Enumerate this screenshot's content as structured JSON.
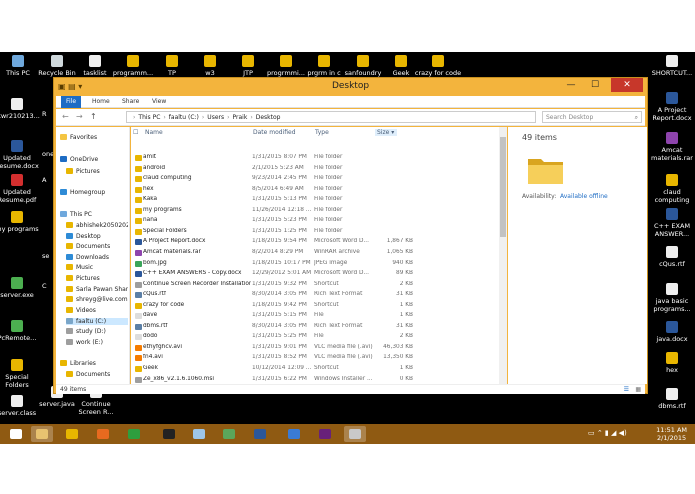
{
  "desktop": {
    "top_icons": [
      {
        "label": "This PC",
        "icon": "this-pc-icon",
        "color": "#6fa8dc"
      },
      {
        "label": "Recycle Bin",
        "icon": "recycle-bin-icon",
        "color": "#cfd8dc"
      },
      {
        "label": "tasklist",
        "icon": "text-file-icon",
        "color": "#eeeeee"
      },
      {
        "label": "programm...",
        "icon": "chrome-shortcut-icon",
        "color": "#e8b600"
      },
      {
        "label": "TP",
        "icon": "chrome-shortcut-icon",
        "color": "#e8b600"
      },
      {
        "label": "w3",
        "icon": "chrome-shortcut-icon",
        "color": "#e8b600"
      },
      {
        "label": "JTP",
        "icon": "chrome-shortcut-icon",
        "color": "#e8b600"
      },
      {
        "label": "progrmmi...",
        "icon": "chrome-shortcut-icon",
        "color": "#e8b600"
      },
      {
        "label": "prgrm in c",
        "icon": "chrome-shortcut-icon",
        "color": "#e8b600"
      },
      {
        "label": "sanfoundry",
        "icon": "chrome-shortcut-icon",
        "color": "#e8b600"
      },
      {
        "label": "Geek",
        "icon": "chrome-shortcut-icon",
        "color": "#e8b600"
      },
      {
        "label": "crazy for code",
        "icon": "chrome-shortcut-icon",
        "color": "#e8b600"
      },
      {
        "label": "SHORTCUT...",
        "icon": "document-icon",
        "color": "#eeeeee"
      }
    ],
    "left_icons": [
      {
        "label": "ptwr210213...",
        "icon": "document-icon",
        "color": "#eeeeee"
      },
      {
        "label": "Updated Resume.docx",
        "icon": "word-doc-icon",
        "color": "#2b579a"
      },
      {
        "label": "Updated Resume.pdf",
        "icon": "pdf-icon",
        "color": "#d32f2f"
      },
      {
        "label": "my programs",
        "icon": "folder-icon",
        "color": "#e8b600"
      },
      {
        "label": "server.exe",
        "icon": "exe-icon",
        "color": "#4caf50"
      },
      {
        "label": "PcRemote...",
        "icon": "exe-icon",
        "color": "#4caf50"
      },
      {
        "label": "Special Folders",
        "icon": "folder-icon",
        "color": "#e8b600"
      },
      {
        "label": "server.class",
        "icon": "java-class-icon",
        "color": "#eeeeee"
      }
    ],
    "left_partial_labels": [
      "R",
      "one",
      "A",
      "se",
      "C"
    ],
    "bottom_icons": [
      {
        "label": "server.java",
        "icon": "java-file-icon",
        "color": "#eeeeee"
      },
      {
        "label": "Continue Screen R...",
        "icon": "shortcut-icon",
        "color": "#eeeeee"
      }
    ],
    "right_icons": [
      {
        "label": "A Project Report.docx",
        "icon": "word-doc-icon",
        "color": "#2b579a"
      },
      {
        "label": "Amcat materials.rar",
        "icon": "rar-icon",
        "color": "#8e44ad"
      },
      {
        "label": "claud computing",
        "icon": "folder-icon",
        "color": "#e8b600"
      },
      {
        "label": "C++ EXAM ANSWER...",
        "icon": "word-doc-icon",
        "color": "#2b579a"
      },
      {
        "label": "cQus.rtf",
        "icon": "rtf-icon",
        "color": "#eeeeee"
      },
      {
        "label": "java basic programs...",
        "icon": "rtf-icon",
        "color": "#eeeeee"
      },
      {
        "label": "java.docx",
        "icon": "word-doc-icon",
        "color": "#2b579a"
      },
      {
        "label": "hex",
        "icon": "folder-icon",
        "color": "#e8b600"
      },
      {
        "label": "dbms.rtf",
        "icon": "rtf-icon",
        "color": "#eeeeee"
      }
    ]
  },
  "window": {
    "title": "Desktop",
    "ribbon_tabs": [
      "File",
      "Home",
      "Share",
      "View"
    ],
    "path": [
      "This PC",
      "faaltu (C:)",
      "Users",
      "Praik",
      "Desktop"
    ],
    "path_sep": "›",
    "search_placeholder": "Search Desktop",
    "nav_back": "←",
    "nav_forward": "→",
    "nav_up": "↑",
    "min": "—",
    "max": "☐",
    "close": "✕",
    "columns": {
      "name": "Name",
      "date": "Date modified",
      "type": "Type",
      "size": "Size"
    },
    "nav_items": [
      {
        "label": "Favorites",
        "icon": "star-icon",
        "color": "#f4c542",
        "indent": 0
      },
      {
        "label": "OneDrive",
        "icon": "cloud-icon",
        "color": "#1e6cc4",
        "indent": 0
      },
      {
        "label": "Pictures",
        "icon": "folder-icon",
        "color": "#e8b600",
        "indent": 1
      },
      {
        "label": "Homegroup",
        "icon": "homegroup-icon",
        "color": "#2e8bd6",
        "indent": 0
      },
      {
        "label": "This PC",
        "icon": "this-pc-icon",
        "color": "#6fa8dc",
        "indent": 0
      },
      {
        "label": "abhishek2050202",
        "icon": "folder-icon",
        "color": "#e8b600",
        "indent": 1
      },
      {
        "label": "Desktop",
        "icon": "desktop-icon",
        "color": "#2e8bd6",
        "indent": 1
      },
      {
        "label": "Documents",
        "icon": "folder-icon",
        "color": "#e8b600",
        "indent": 1
      },
      {
        "label": "Downloads",
        "icon": "download-icon",
        "color": "#2e8bd6",
        "indent": 1
      },
      {
        "label": "Music",
        "icon": "music-icon",
        "color": "#e8b600",
        "indent": 1
      },
      {
        "label": "Pictures",
        "icon": "folder-icon",
        "color": "#e8b600",
        "indent": 1
      },
      {
        "label": "Sarla Pawan Shar",
        "icon": "folder-icon",
        "color": "#e8b600",
        "indent": 1
      },
      {
        "label": "shreyg@live.com",
        "icon": "folder-icon",
        "color": "#e8b600",
        "indent": 1
      },
      {
        "label": "Videos",
        "icon": "video-icon",
        "color": "#e8b600",
        "indent": 1
      },
      {
        "label": "faaltu (C:)",
        "icon": "drive-icon",
        "color": "#7aa6c9",
        "indent": 1,
        "selected": true
      },
      {
        "label": "study (D:)",
        "icon": "drive-icon",
        "color": "#9e9e9e",
        "indent": 1
      },
      {
        "label": "work (E:)",
        "icon": "drive-icon",
        "color": "#9e9e9e",
        "indent": 1
      },
      {
        "label": "Libraries",
        "icon": "library-icon",
        "color": "#e8b600",
        "indent": 0
      },
      {
        "label": "Documents",
        "icon": "folder-icon",
        "color": "#e8b600",
        "indent": 1
      }
    ],
    "files": [
      {
        "name": "amit",
        "date": "1/31/2015 8:07 PM",
        "type": "File folder",
        "size": "",
        "color": "#e8b600"
      },
      {
        "name": "android",
        "date": "2/1/2015 5:23 AM",
        "type": "File folder",
        "size": "",
        "color": "#e8b600"
      },
      {
        "name": "claud computing",
        "date": "9/23/2014 2:45 PM",
        "type": "File folder",
        "size": "",
        "color": "#e8b600"
      },
      {
        "name": "hex",
        "date": "8/5/2014 6:49 AM",
        "type": "File folder",
        "size": "",
        "color": "#e8b600"
      },
      {
        "name": "Kaka",
        "date": "1/31/2015 5:13 PM",
        "type": "File folder",
        "size": "",
        "color": "#e8b600"
      },
      {
        "name": "my programs",
        "date": "11/26/2014 12:18 ...",
        "type": "File folder",
        "size": "",
        "color": "#e8b600"
      },
      {
        "name": "nana",
        "date": "1/31/2015 5:23 PM",
        "type": "File folder",
        "size": "",
        "color": "#e8b600"
      },
      {
        "name": "Special Folders",
        "date": "1/31/2015 1:25 PM",
        "type": "File folder",
        "size": "",
        "color": "#e8b600"
      },
      {
        "name": "A Project Report.docx",
        "date": "1/18/2015 9:54 PM",
        "type": "Microsoft Word D...",
        "size": "1,867 KB",
        "color": "#2b579a"
      },
      {
        "name": "Amcat materials.rar",
        "date": "8/2/2014 8:29 PM",
        "type": "WinRAR archive",
        "size": "1,065 KB",
        "color": "#8e44ad"
      },
      {
        "name": "bom.jpg",
        "date": "1/18/2015 10:17 PM",
        "type": "JPEG image",
        "size": "940 KB",
        "color": "#3aa55a"
      },
      {
        "name": "C++ EXAM ANSWERS - Copy.docx",
        "date": "12/29/2012 5:01 AM",
        "type": "Microsoft Word D...",
        "size": "89 KB",
        "color": "#2b579a"
      },
      {
        "name": "Continue Screen Recorder Installation",
        "date": "1/31/2015 9:32 PM",
        "type": "Shortcut",
        "size": "2 KB",
        "color": "#9e9e9e"
      },
      {
        "name": "cQus.rtf",
        "date": "8/30/2014 3:05 PM",
        "type": "Rich Text Format",
        "size": "31 KB",
        "color": "#5b7fa6"
      },
      {
        "name": "crazy for code",
        "date": "1/18/2015 9:42 PM",
        "type": "Shortcut",
        "size": "1 KB",
        "color": "#e8b600"
      },
      {
        "name": "dave",
        "date": "1/31/2015 5:15 PM",
        "type": "File",
        "size": "1 KB",
        "color": "#dddddd"
      },
      {
        "name": "dbms.rtf",
        "date": "8/30/2014 3:05 PM",
        "type": "Rich Text Format",
        "size": "31 KB",
        "color": "#5b7fa6"
      },
      {
        "name": "dodo",
        "date": "1/31/2015 5:25 PM",
        "type": "File",
        "size": "2 KB",
        "color": "#dddddd"
      },
      {
        "name": "ethyfghcv.avi",
        "date": "1/31/2015 9:01 PM",
        "type": "VLC media file (.avi)",
        "size": "46,303 KB",
        "color": "#f57c00"
      },
      {
        "name": "fn4.avi",
        "date": "1/31/2015 8:52 PM",
        "type": "VLC media file (.avi)",
        "size": "13,350 KB",
        "color": "#f57c00"
      },
      {
        "name": "Geek",
        "date": "10/12/2014 12:09 ...",
        "type": "Shortcut",
        "size": "1 KB",
        "color": "#e8b600"
      },
      {
        "name": "Ze_x86_v2.1.6.1060.msi",
        "date": "1/31/2015 6:22 PM",
        "type": "Windows Installer ...",
        "size": "0 KB",
        "color": "#9e9e9e"
      }
    ],
    "details": {
      "count": "49 items",
      "availability_label": "Availability:",
      "availability_value": "Available offline"
    },
    "status": "49 items"
  },
  "taskbar": {
    "apps": [
      {
        "name": "start-button",
        "color": "#ffffff"
      },
      {
        "name": "file-explorer-taskbar-icon",
        "color": "#e8c270"
      },
      {
        "name": "chrome-taskbar-icon",
        "color": "#e8b600"
      },
      {
        "name": "firefox-taskbar-icon",
        "color": "#e86a1f"
      },
      {
        "name": "store-taskbar-icon",
        "color": "#2e9e3e"
      },
      {
        "name": "cmd-taskbar-icon",
        "color": "#222222"
      },
      {
        "name": "notepad-taskbar-icon",
        "color": "#9ec6e8"
      },
      {
        "name": "image-viewer-taskbar-icon",
        "color": "#5ba65b"
      },
      {
        "name": "word-taskbar-icon",
        "color": "#2b579a"
      },
      {
        "name": "paint-taskbar-icon",
        "color": "#3a7bd5"
      },
      {
        "name": "visual-studio-taskbar-icon",
        "color": "#68217a"
      },
      {
        "name": "remote-taskbar-icon",
        "color": "#c9c9c9"
      }
    ],
    "time": "11:51 AM",
    "date": "2/1/2015"
  }
}
